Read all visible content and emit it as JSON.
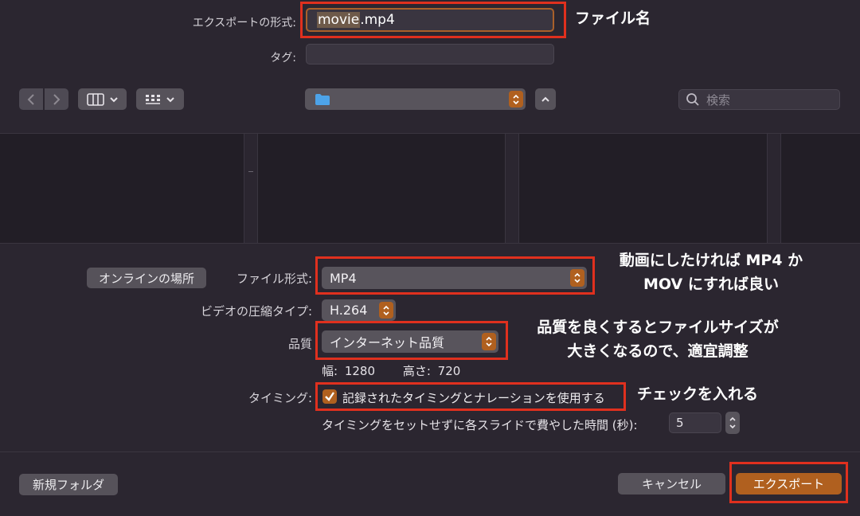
{
  "top": {
    "export_as_label": "エクスポートの形式:",
    "filename_highlight": "movie",
    "filename_ext": ".mp4",
    "tags_label": "タグ:"
  },
  "toolbar": {
    "search_placeholder": "検索"
  },
  "options": {
    "online_locations_label": "オンラインの場所",
    "file_format_label": "ファイル形式:",
    "file_format_value": "MP4",
    "video_compression_label": "ビデオの圧縮タイプ:",
    "video_compression_value": "H.264",
    "quality_label": "品質",
    "quality_value": "インターネット品質",
    "width_label": "幅:",
    "width_value": "1280",
    "height_label": "高さ:",
    "height_value": "720",
    "timing_label": "タイミング:",
    "timing_checkbox_label": "記録されたタイミングとナレーションを使用する",
    "timing_checked": true,
    "per_slide_label": "タイミングをセットせずに各スライドで費やした時間 (秒):",
    "per_slide_value": "5"
  },
  "footer": {
    "new_folder_label": "新規フォルダ",
    "cancel_label": "キャンセル",
    "export_label": "エクスポート"
  },
  "annotations": {
    "filename_note": "ファイル名",
    "format_note_line1": "動画にしたければ MP4 か",
    "format_note_line2": "MOV にすれば良い",
    "quality_note_line1": "品質を良くするとファイルサイズが",
    "quality_note_line2": "大きくなるので、適宜調整",
    "timing_note": "チェックを入れる"
  },
  "colors": {
    "accent": "#b0601f",
    "annotation_red": "#e0301e",
    "background": "#2b2630"
  }
}
